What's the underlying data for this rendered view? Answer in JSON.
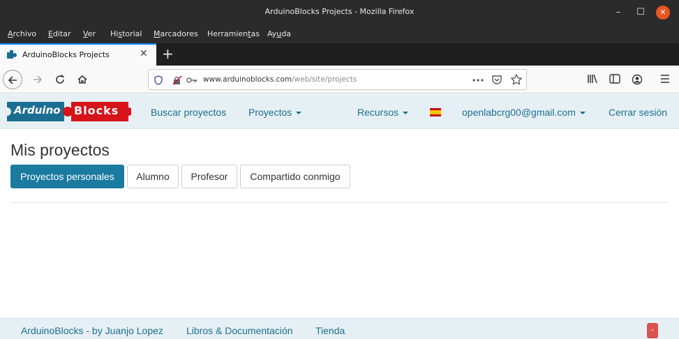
{
  "window": {
    "title": "ArduinoBlocks Projects - Mozilla Firefox",
    "minimize_glyph": "–",
    "maximize_glyph": "☐",
    "close_glyph": "✕"
  },
  "menubar": {
    "items": [
      {
        "pre": "",
        "ul": "A",
        "post": "rchivo"
      },
      {
        "pre": "",
        "ul": "E",
        "post": "ditar"
      },
      {
        "pre": "",
        "ul": "V",
        "post": "er"
      },
      {
        "pre": "Hi",
        "ul": "s",
        "post": "torial"
      },
      {
        "pre": "",
        "ul": "M",
        "post": "arcadores"
      },
      {
        "pre": "Herramien",
        "ul": "t",
        "post": "as"
      },
      {
        "pre": "Ay",
        "ul": "u",
        "post": "da"
      }
    ]
  },
  "browser_tab": {
    "title": "ArduinoBlocks Projects",
    "close_glyph": "✕",
    "new_tab_glyph": "+"
  },
  "url": {
    "host": "www.arduinoblocks.com",
    "path": "/web/site/projects"
  },
  "site": {
    "logo_word1": "Arduino",
    "logo_word2": "Blocks",
    "nav": {
      "search": "Buscar proyectos",
      "projects": "Proyectos",
      "resources": "Recursos",
      "user": "openlabcrg00@gmail.com",
      "logout": "Cerrar sesión"
    },
    "colors": {
      "header_bg": "#e6f0f4",
      "link": "#1b6e92",
      "active_tab": "#1b7aa0",
      "logo_blue": "#1b6e92",
      "logo_red": "#d7141a"
    }
  },
  "main": {
    "title": "Mis proyectos",
    "tabs": [
      "Proyectos personales",
      "Alumno",
      "Profesor",
      "Compartido conmigo"
    ],
    "active_tab": "Proyectos personales"
  },
  "footer": {
    "credit": "ArduinoBlocks - by Juanjo Lopez",
    "docs": "Libros & Documentación",
    "shop": "Tienda",
    "collapse_glyph": "-"
  }
}
